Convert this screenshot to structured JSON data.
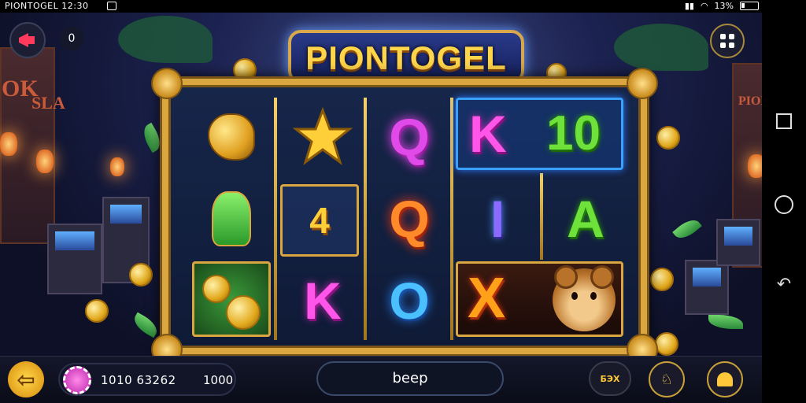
{
  "status_bar": {
    "title": "PIONTOGEL 12:30",
    "battery": "13%"
  },
  "header": {
    "logo_text": "PIONTOGEL",
    "counter": "0"
  },
  "background_signs": [
    "OK",
    "SLA",
    "PIONT"
  ],
  "reels": {
    "symbols": [
      [
        "gold-swirl",
        "green-plant",
        "gold-coins"
      ],
      [
        "gold-star",
        "4",
        "K"
      ],
      [
        "Q",
        "Q",
        "O"
      ],
      [
        "K",
        "I",
        "X"
      ],
      [
        "10",
        "A",
        "bear"
      ]
    ],
    "labels": {
      "k1": "K",
      "k2": "K",
      "ten": "10",
      "a": "A",
      "q1": "Q",
      "q2": "Q",
      "o": "O",
      "four": "4",
      "x": "X",
      "j": "I"
    }
  },
  "bottom_bar": {
    "balance": "1010 63262",
    "bet": "1000",
    "spin_label": "beep",
    "bet_button_label": "БЭХ"
  },
  "colors": {
    "frame_gold": "#d9a63f",
    "logo_text": "#ffd54a",
    "accent_blue": "#3aa0ff"
  },
  "icons": {
    "top_left": "megaphone-icon",
    "menu": "grid-menu-icon",
    "close": "close-icon",
    "back": "arrow-left-icon",
    "auto": "auto-spin-icon",
    "bell": "bell-icon",
    "gold": "refresh-icon"
  }
}
